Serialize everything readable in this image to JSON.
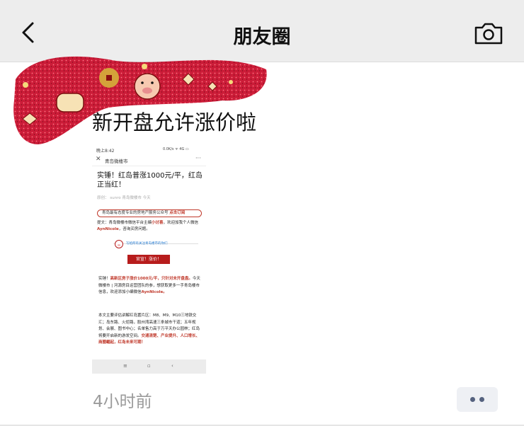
{
  "nav": {
    "title": "朋友圈",
    "back_icon": "back-chevron-icon",
    "camera_icon": "camera-icon"
  },
  "post": {
    "text": "新开盘允许涨价啦",
    "time": "4小时前",
    "more_icon": "more-dots-icon"
  },
  "article": {
    "status_time": "晚上8:42",
    "status_right": "0.0K/s ᯤ 4G ▭",
    "account": "青岛微楼市",
    "headline": "实锤！红岛普涨1000元/平，红岛正当红！",
    "author_line": "原创： sunro  青岛微楼市  今天",
    "pill_text": "青岛最有态度专业的房地产服务公众号",
    "pill_cta": "点击订阅",
    "intro_prefix": "提文：青岛微楼市微信平台主编",
    "intro_highlight": "小讨喜",
    "intro_suffix": "，欢迎加我个人微信",
    "intro_wechat": "AynNicole",
    "intro_end": "，咨询买房问题。",
    "tagline": "写给所有关注青岛楼市的你们",
    "button_label": "官宣！涨价！",
    "para1_prefix": "实锤！",
    "para1_highlight": "高新区房子涨价1000元/平，只针对未开盘盘。",
    "para1_rest": "今天微楼市 | 河源房目运营团队的参，想获取更多一手青岛楼市信息，欢迎添加小编微信",
    "para1_wechat": "AynNicole。",
    "para2_rest": "本文主要评估讲解红岛置片区：M8、M9、M10三地铁交汇；岛东路、火炬路，胶州湾高速三条城市干道；五年规划、会展、图书中心；名单售力高于万平天办公园林；红岛将要开启新的游发空间。",
    "para2_highlight": "交通清楚、产业提升、人口增长、商圈崛起，红岛未来可期！",
    "nav_menu": "≡",
    "nav_home": "▫",
    "nav_back": "‹",
    "accent_red": "#b71c1c",
    "link_blue": "#2a7fd4"
  },
  "colors": {
    "navbar_bg": "#ededed",
    "time_gray": "#9b9b9b",
    "more_dot": "#55627f"
  }
}
